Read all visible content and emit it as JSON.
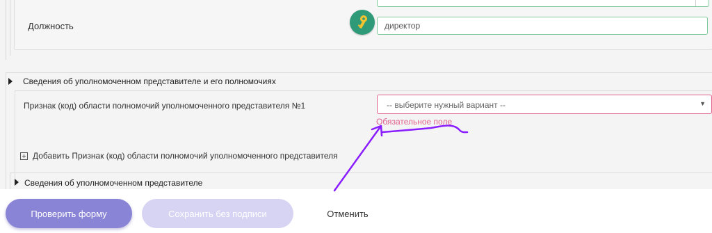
{
  "signer": {
    "position_label": "Должность",
    "position_value": "директор",
    "key_icon": "key-icon"
  },
  "representative_section": {
    "title": "Сведения об уполномоченном представителе и его полномочиях",
    "field_label": "Признак (код) области полномочий уполномоченного представителя №1",
    "select_placeholder": "-- выберите нужный вариант --",
    "error_text": "Обязательное поле",
    "add_label": "Добавить Признак (код) области полномочий уполномоченного представителя"
  },
  "subsection": {
    "title": "Сведения об уполномоченном представителе"
  },
  "actions": {
    "check_label": "Проверить форму",
    "save_label": "Сохранить без подписи",
    "cancel_label": "Отменить"
  },
  "colors": {
    "accent": "#8a84d6",
    "error": "#e0608e",
    "valid_border": "#7fc99a",
    "key_badge": "#2e9a78",
    "annotation": "#8a1dff"
  }
}
